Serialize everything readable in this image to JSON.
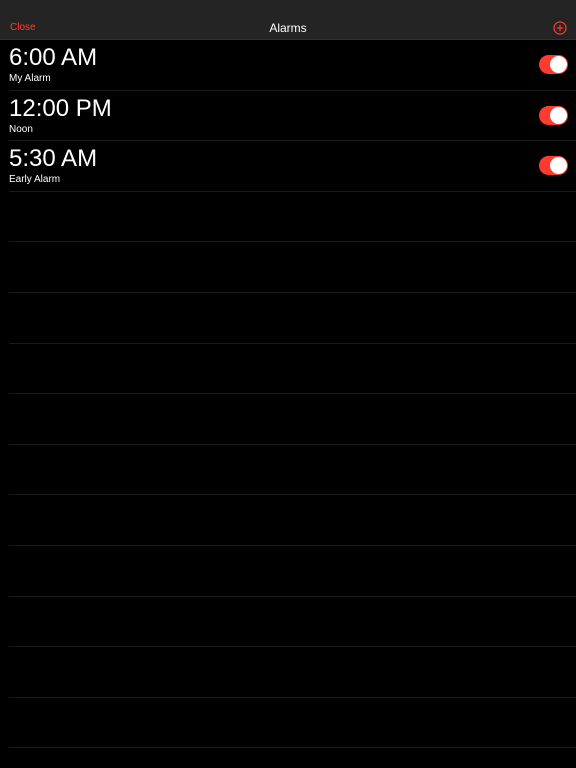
{
  "navbar": {
    "close_label": "Close",
    "title": "Alarms",
    "add_icon": "plus-circle-icon"
  },
  "colors": {
    "accent": "#ff3b2f",
    "navbar_bg": "#242424",
    "background": "#000000",
    "text": "#ffffff"
  },
  "alarms": [
    {
      "time": "6:00 AM",
      "label": "My Alarm",
      "enabled": true
    },
    {
      "time": "12:00 PM",
      "label": "Noon",
      "enabled": true
    },
    {
      "time": "5:30 AM",
      "label": "Early Alarm",
      "enabled": true
    }
  ]
}
